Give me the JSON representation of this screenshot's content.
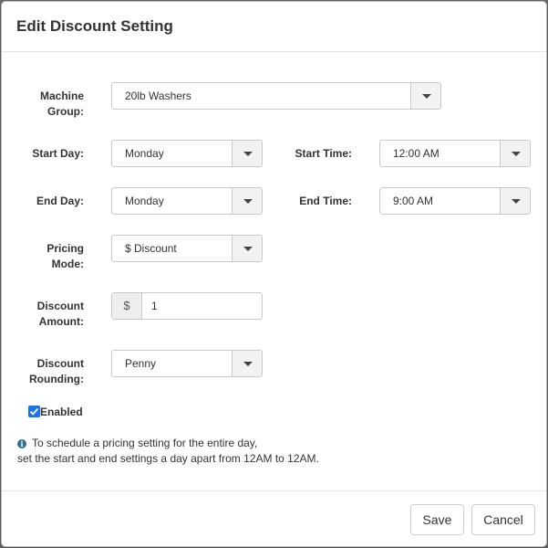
{
  "dialog": {
    "title": "Edit Discount Setting"
  },
  "form": {
    "machine_group": {
      "label_line1": "Machine",
      "label_line2": "Group:",
      "value": "20lb Washers"
    },
    "start_day": {
      "label": "Start Day:",
      "value": "Monday"
    },
    "start_time": {
      "label": "Start Time:",
      "value": "12:00 AM"
    },
    "end_day": {
      "label": "End Day:",
      "value": "Monday"
    },
    "end_time": {
      "label": "End Time:",
      "value": "9:00 AM"
    },
    "pricing_mode": {
      "label_line1": "Pricing",
      "label_line2": "Mode:",
      "value": "$ Discount"
    },
    "discount_amount": {
      "label_line1": "Discount",
      "label_line2": "Amount:",
      "addon": "$",
      "value": "1"
    },
    "discount_rounding": {
      "label_line1": "Discount",
      "label_line2": "Rounding:",
      "value": "Penny"
    },
    "enabled": {
      "label": "Enabled",
      "checked": true
    }
  },
  "info": {
    "line1": "To schedule a pricing setting for the entire day,",
    "line2": "set the start and end settings a day apart from 12AM to 12AM."
  },
  "footer": {
    "save_label": "Save",
    "cancel_label": "Cancel"
  },
  "colors": {
    "accent": "#1a73e8",
    "info_icon": "#31708f"
  }
}
